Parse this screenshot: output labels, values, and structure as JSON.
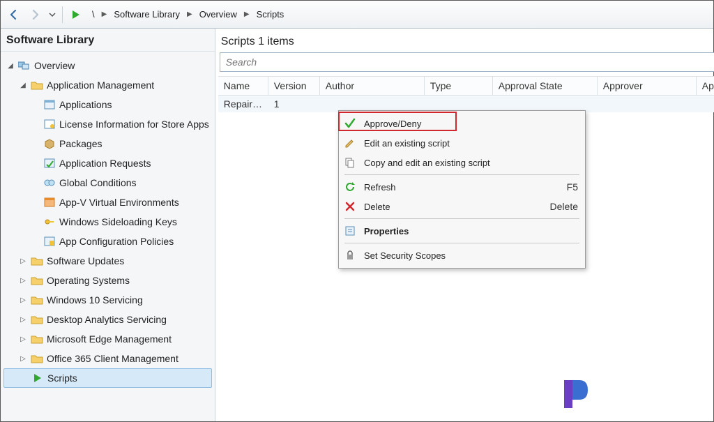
{
  "toolbar": {
    "breadcrumb": {
      "root": "\\",
      "n1": "Software Library",
      "n2": "Overview",
      "n3": "Scripts"
    }
  },
  "sidebar": {
    "title": "Software Library",
    "overview": "Overview",
    "appmgmt": "Application Management",
    "items_app": {
      "applications": "Applications",
      "license": "License Information for Store Apps",
      "packages": "Packages",
      "requests": "Application Requests",
      "globalcond": "Global Conditions",
      "appv": "App-V Virtual Environments",
      "sideload": "Windows Sideloading Keys",
      "appconfig": "App Configuration Policies"
    },
    "others": {
      "swupdates": "Software Updates",
      "os": "Operating Systems",
      "win10": "Windows 10 Servicing",
      "desktop": "Desktop Analytics Servicing",
      "edge": "Microsoft Edge Management",
      "o365": "Office 365 Client Management",
      "scripts": "Scripts"
    }
  },
  "content": {
    "title": "Scripts 1 items",
    "search_placeholder": "Search",
    "columns": {
      "name": "Name",
      "version": "Version",
      "author": "Author",
      "type": "Type",
      "approval": "Approval State",
      "approver": "Approver",
      "approver2": "Approver"
    },
    "row": {
      "name": "Repair…",
      "version": "1"
    }
  },
  "context_menu": {
    "approve": "Approve/Deny",
    "edit": "Edit an existing script",
    "copy": "Copy and edit an existing script",
    "refresh": "Refresh",
    "refresh_sc": "F5",
    "delete": "Delete",
    "delete_sc": "Delete",
    "properties": "Properties",
    "security": "Set Security Scopes"
  }
}
